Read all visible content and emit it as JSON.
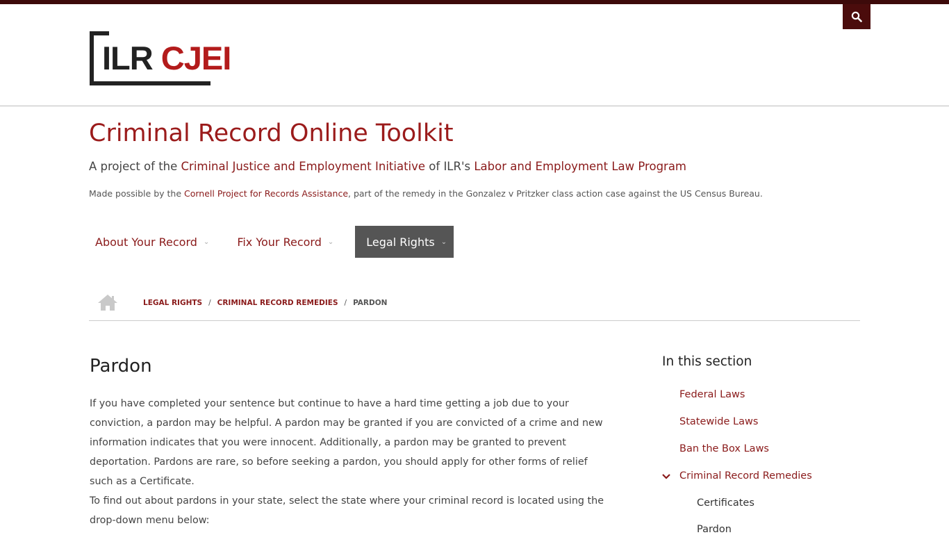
{
  "header": {
    "logo": {
      "part1": "ILR",
      "part2": "CJEI"
    },
    "search_icon": "search-icon"
  },
  "site": {
    "title": "Criminal Record Online Toolkit",
    "tagline": {
      "prefix": "A project of the ",
      "link1": "Criminal Justice and Employment Initiative",
      "middle": " of ILR's ",
      "link2": "Labor and Employment Law Program"
    },
    "made_possible": {
      "prefix": "Made possible by the ",
      "link": "Cornell Project for Records Assistance",
      "suffix": ", part of the remedy in the Gonzalez v Pritzker class action case against the US Census Bureau."
    }
  },
  "nav": {
    "items": [
      {
        "label": "About Your Record"
      },
      {
        "label": "Fix Your Record"
      },
      {
        "label": "Legal Rights"
      }
    ]
  },
  "breadcrumb": {
    "home_icon": "home-icon",
    "items": [
      "Legal Rights",
      "Criminal Record Remedies"
    ],
    "current": "Pardon",
    "separator": "/"
  },
  "main": {
    "heading": "Pardon",
    "paragraphs": [
      "If you have completed your sentence but continue to have a hard time getting a job due to your conviction, a pardon may be helpful. A pardon may be granted if you are convicted of a crime and new information indicates that you were innocent. Additionally, a pardon may be granted to prevent deportation. Pardons are rare, so before seeking a pardon, you should apply for other forms of relief such as a Certificate.",
      "To find out about pardons in your state, select the state where your criminal record is located using the drop-down menu below:"
    ]
  },
  "sidebar": {
    "title": "In this section",
    "links": [
      "Federal Laws",
      "Statewide Laws",
      "Ban the Box Laws",
      "Criminal Record Remedies"
    ],
    "children": [
      "Certificates",
      "Pardon"
    ]
  },
  "colors": {
    "brand": "#9b1b1b",
    "topbar": "#3d0a0a",
    "nav_active": "#555555"
  }
}
